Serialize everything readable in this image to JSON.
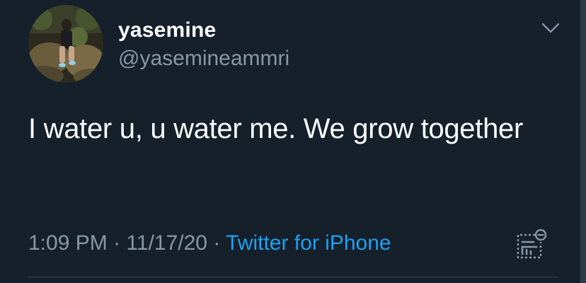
{
  "tweet": {
    "display_name": "yasemine",
    "handle": "@yasemineammri",
    "text": "I water u, u water me. We grow together",
    "time": "1:09 PM",
    "separator": "·",
    "date": "11/17/20",
    "source": "Twitter for iPhone"
  },
  "icons": {
    "more": "chevron-down-icon",
    "analytics": "tweet-analytics-icon"
  },
  "colors": {
    "background": "#15202b",
    "primary_text": "#ffffff",
    "secondary_text": "#8899a6",
    "link": "#1da1f2",
    "divider": "#38444d"
  }
}
